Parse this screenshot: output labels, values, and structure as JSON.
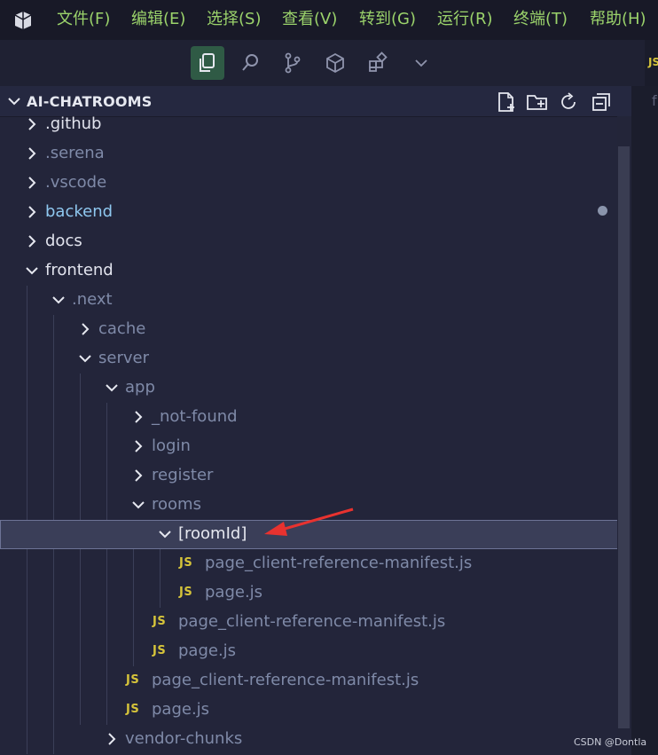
{
  "menubar": {
    "logo_icon": "vscode-logo-icon",
    "items": [
      "文件(F)",
      "编辑(E)",
      "选择(S)",
      "查看(V)",
      "转到(G)",
      "运行(R)",
      "终端(T)",
      "帮助(H)"
    ]
  },
  "toolbar": {
    "icons": [
      "explorer-icon",
      "search-icon",
      "source-control-icon",
      "package-icon",
      "extensions-icon",
      "more-chevron-icon"
    ],
    "active": "explorer-icon"
  },
  "editor_tab": {
    "icon_text": "JS"
  },
  "explorer": {
    "title": "AI-CHATROOMS",
    "actions": [
      "new-file-icon",
      "new-folder-icon",
      "refresh-icon",
      "collapse-all-icon"
    ]
  },
  "tree": [
    {
      "label": ".github",
      "type": "folder",
      "expanded": false,
      "depth": 1,
      "color": "#e2e4ee"
    },
    {
      "label": ".serena",
      "type": "folder",
      "expanded": false,
      "depth": 1,
      "color": "#7f8aa8"
    },
    {
      "label": ".vscode",
      "type": "folder",
      "expanded": false,
      "depth": 1,
      "color": "#7f8aa8"
    },
    {
      "label": "backend",
      "type": "folder",
      "expanded": false,
      "depth": 1,
      "color": "#8fc8f0"
    },
    {
      "label": "docs",
      "type": "folder",
      "expanded": false,
      "depth": 1,
      "color": "#e2e4ee"
    },
    {
      "label": "frontend",
      "type": "folder",
      "expanded": true,
      "depth": 1,
      "color": "#e2e4ee"
    },
    {
      "label": ".next",
      "type": "folder",
      "expanded": true,
      "depth": 2,
      "color": "#7f8aa8"
    },
    {
      "label": "cache",
      "type": "folder",
      "expanded": false,
      "depth": 3,
      "color": "#7f8aa8"
    },
    {
      "label": "server",
      "type": "folder",
      "expanded": true,
      "depth": 3,
      "color": "#7f8aa8"
    },
    {
      "label": "app",
      "type": "folder",
      "expanded": true,
      "depth": 4,
      "color": "#7f8aa8"
    },
    {
      "label": "_not-found",
      "type": "folder",
      "expanded": false,
      "depth": 5,
      "color": "#7f8aa8"
    },
    {
      "label": "login",
      "type": "folder",
      "expanded": false,
      "depth": 5,
      "color": "#7f8aa8"
    },
    {
      "label": "register",
      "type": "folder",
      "expanded": false,
      "depth": 5,
      "color": "#7f8aa8"
    },
    {
      "label": "rooms",
      "type": "folder",
      "expanded": true,
      "depth": 5,
      "color": "#7f8aa8"
    },
    {
      "label": "[roomId]",
      "type": "folder",
      "expanded": true,
      "depth": 6,
      "color": "#e6e8f0",
      "selected": true
    },
    {
      "label": "page_client-reference-manifest.js",
      "type": "js",
      "depth": 7,
      "color": "#7f8aa8"
    },
    {
      "label": "page.js",
      "type": "js",
      "depth": 7,
      "color": "#7f8aa8"
    },
    {
      "label": "page_client-reference-manifest.js",
      "type": "js",
      "depth": 6,
      "color": "#7f8aa8"
    },
    {
      "label": "page.js",
      "type": "js",
      "depth": 6,
      "color": "#7f8aa8"
    },
    {
      "label": "page_client-reference-manifest.js",
      "type": "js",
      "depth": 5,
      "color": "#7f8aa8"
    },
    {
      "label": "page.js",
      "type": "js",
      "depth": 5,
      "color": "#7f8aa8"
    },
    {
      "label": "vendor-chunks",
      "type": "folder",
      "expanded": false,
      "depth": 4,
      "color": "#7f8aa8"
    }
  ],
  "js_icon_text": "JS",
  "right_editor_text": "f",
  "watermark": "CSDN @Dontla",
  "colors": {
    "menu_text": "#9bd36b",
    "js_icon": "#d6c43a",
    "arrow": "#e8322f"
  }
}
